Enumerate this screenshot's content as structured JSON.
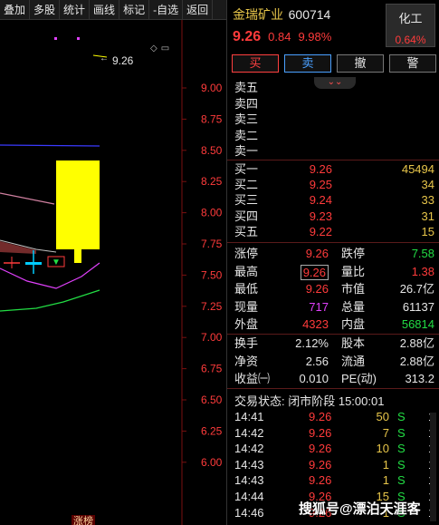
{
  "toolbar": [
    "多股",
    "统计",
    "画线",
    "标记",
    "-自选",
    "返回"
  ],
  "toolbar_left": [
    "叠加"
  ],
  "chart": {
    "price_ticks": [
      "9.00",
      "8.75",
      "8.50",
      "8.25",
      "8.00",
      "7.75",
      "7.50",
      "7.25",
      "7.00",
      "6.75",
      "6.50",
      "6.25",
      "6.00"
    ],
    "high_annotation": "9.26",
    "bottom_tag": "涨榜"
  },
  "stock": {
    "name": "金瑞矿业",
    "code": "600714",
    "price": "9.26",
    "change": "0.84",
    "pct": "9.98%",
    "sector_name": "化工",
    "sector_pct": "0.64%"
  },
  "trade_buttons": {
    "buy": "买",
    "sell": "卖",
    "cancel": "撤",
    "alert": "警"
  },
  "sell_levels": [
    "卖五",
    "卖四",
    "卖三",
    "卖二",
    "卖一"
  ],
  "buy_levels": [
    {
      "label": "买一",
      "price": "9.26",
      "vol": "45494"
    },
    {
      "label": "买二",
      "price": "9.25",
      "vol": "34"
    },
    {
      "label": "买三",
      "price": "9.24",
      "vol": "33"
    },
    {
      "label": "买四",
      "price": "9.23",
      "vol": "31"
    },
    {
      "label": "买五",
      "price": "9.22",
      "vol": "15"
    }
  ],
  "stats1": [
    {
      "l1": "涨停",
      "v1": "9.26",
      "c1": "red",
      "l2": "跌停",
      "v2": "7.58",
      "c2": "green"
    },
    {
      "l1": "最高",
      "v1": "9.26",
      "c1": "red",
      "l2": "量比",
      "v2": "1.38",
      "c2": "red"
    },
    {
      "l1": "最低",
      "v1": "9.26",
      "c1": "red",
      "l2": "市值",
      "v2": "26.7亿",
      "c2": "white"
    },
    {
      "l1": "现量",
      "v1": "717",
      "c1": "purple",
      "l2": "总量",
      "v2": "61137",
      "c2": "white"
    },
    {
      "l1": "外盘",
      "v1": "4323",
      "c1": "red",
      "l2": "内盘",
      "v2": "56814",
      "c2": "green"
    }
  ],
  "stats2": [
    {
      "l1": "换手",
      "v1": "2.12%",
      "c1": "white",
      "l2": "股本",
      "v2": "2.88亿",
      "c2": "white"
    },
    {
      "l1": "净资",
      "v1": "2.56",
      "c1": "white",
      "l2": "流通",
      "v2": "2.88亿",
      "c2": "white"
    },
    {
      "l1": "收益㈠",
      "v1": "0.010",
      "c1": "white",
      "l2": "PE(动)",
      "v2": "313.2",
      "c2": "white"
    }
  ],
  "status_line": "交易状态: 闭市阶段 15:00:01",
  "ticks": [
    {
      "t": "14:41",
      "p": "9.26",
      "v": "50",
      "f": "S",
      "n": "1"
    },
    {
      "t": "14:42",
      "p": "9.26",
      "v": "7",
      "f": "S",
      "n": "1"
    },
    {
      "t": "14:42",
      "p": "9.26",
      "v": "10",
      "f": "S",
      "n": "1"
    },
    {
      "t": "14:43",
      "p": "9.26",
      "v": "1",
      "f": "S",
      "n": "1"
    },
    {
      "t": "14:43",
      "p": "9.26",
      "v": "1",
      "f": "S",
      "n": "1"
    },
    {
      "t": "14:44",
      "p": "9.26",
      "v": "15",
      "f": "S",
      "n": "1"
    },
    {
      "t": "14:46",
      "p": "9.26",
      "v": "1",
      "f": "S",
      "n": "1"
    }
  ],
  "watermark": "搜狐号@漂泊天涯客"
}
